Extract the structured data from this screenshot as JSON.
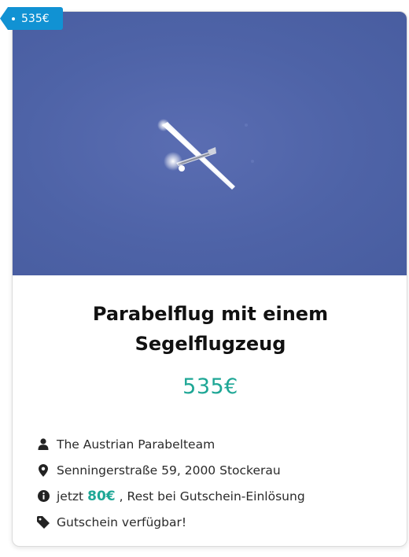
{
  "badge": {
    "price": "535€"
  },
  "listing": {
    "title_line1": "Parabelflug mit einem",
    "title_line2": "Segelflugzeug",
    "price": "535€",
    "details": [
      {
        "icon": "user-icon",
        "text": "The Austrian Parabelteam"
      },
      {
        "icon": "location-pin-icon",
        "text": "Senningerstraße 59, 2000 Stockerau"
      },
      {
        "icon": "info-icon",
        "prefix": "jetzt",
        "highlight": "80€",
        "suffix": ", Rest bei Gutschein-Einlösung"
      },
      {
        "icon": "tag-icon",
        "text": "Gutschein verfügbar!"
      }
    ]
  },
  "colors": {
    "accent": "#1fa796",
    "badge": "#1192d3",
    "sky": "#4e63a7"
  }
}
